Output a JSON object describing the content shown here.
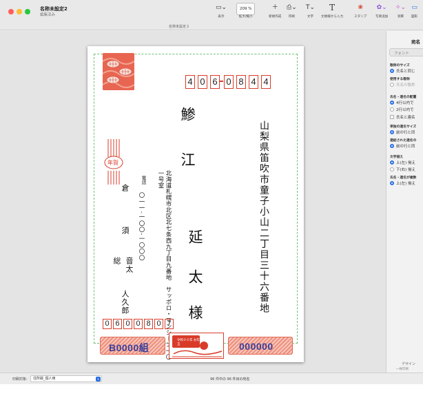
{
  "window": {
    "title": "名称未設定2",
    "subtitle": "編集済み",
    "document_label": "名称未設定２"
  },
  "toolbar": {
    "view_label": "表示",
    "zoom_value": "209 %",
    "zoom_label": "拡大/縮小",
    "new_label": "新規作成",
    "print_label": "印刷",
    "text_label": "文字",
    "input_label": "文規様から入力",
    "stamp_label": "スタンプ",
    "photo_label": "写真追加",
    "decor_label": "装飾",
    "shape_label": "図形"
  },
  "card": {
    "postal_digits": [
      "4",
      "0",
      "6",
      "0",
      "8",
      "4",
      "4"
    ],
    "address": "山梨県笛吹市童子小山二丁目三十六番地",
    "recipient_name": [
      "鯵",
      "江",
      "延",
      "太",
      "様"
    ],
    "sender_address": "北海道札幌市北区北七条西九丁目九番地　サッポロ・マンション一〇一号室",
    "sender_tel_label": "電話",
    "sender_tel": "〇一一-一〇〇-一〇〇〇",
    "sender_names": [
      "倉",
      "須",
      "総",
      "音太",
      "人久郎"
    ],
    "sender_postal": [
      "0",
      "6",
      "0",
      "0",
      "8",
      "0",
      "7"
    ],
    "lottery_left": "B0000組",
    "lottery_right": "000000",
    "center_tag": "令和００年 お年玉",
    "nenga_mark": "年賀"
  },
  "panel": {
    "title": "宛名",
    "tab": "フォント",
    "sec_title_size": "敬称のサイズ",
    "opt_same": "氏名と同じ",
    "sec_honorific": "使用する敬称",
    "opt_honorific": "氏名の敬称",
    "sec_joint": "氏名・連名の配置",
    "opt_four": "4行以内で",
    "opt_two": "2行以内で",
    "opt_name_joint": "氏名と連名",
    "sec_single": "単独の連名サイズ",
    "opt_prev1": "前の行と同",
    "sec_linked": "連結された連名の",
    "opt_prev2": "前の行と同",
    "sec_align": "文字揃え",
    "opt_top_left": "上(左) 揃え",
    "opt_bottom_right": "下(右) 揃え",
    "sec_name_align": "氏名・連名が複数",
    "opt_top_left2": "上(左) 揃え",
    "footer1": "デザイン",
    "footer2": "一枚印刷"
  },
  "status": {
    "print_target_label": "印刷対象:",
    "print_target_value": "住所録_個人用",
    "page_info": "96 件中の 96 件目の宛名"
  },
  "colors": {
    "accent": "#2b6fe0",
    "postal_red": "#d93b2a",
    "lottery_blue": "#3a3f9b"
  }
}
